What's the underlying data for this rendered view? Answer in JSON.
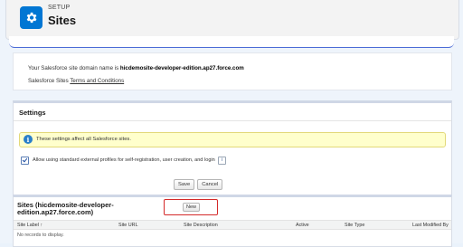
{
  "header": {
    "eyebrow": "SETUP",
    "title": "Sites",
    "icon": "gear-icon",
    "accent": "#0176d3"
  },
  "info": {
    "domain_prefix": "Your Salesforce site domain name is ",
    "domain": "hicdemosite-developer-edition.ap27.force.com",
    "terms_prefix": "Salesforce Sites ",
    "terms_link": "Terms and Conditions"
  },
  "settings": {
    "title": "Settings",
    "message": "These settings affect all Salesforce sites.",
    "checkbox_label": "Allow using standard external profiles for self-registration, user creation, and login",
    "checkbox_checked": true,
    "save_label": "Save",
    "cancel_label": "Cancel"
  },
  "sites": {
    "title": "Sites (hicdemosite-developer-edition.ap27.force.com)",
    "new_label": "New",
    "columns": [
      "Site Label ↑",
      "Site URL",
      "Site Description",
      "Active",
      "Site Type",
      "Last Modified By"
    ],
    "empty_text": "No records to display."
  }
}
